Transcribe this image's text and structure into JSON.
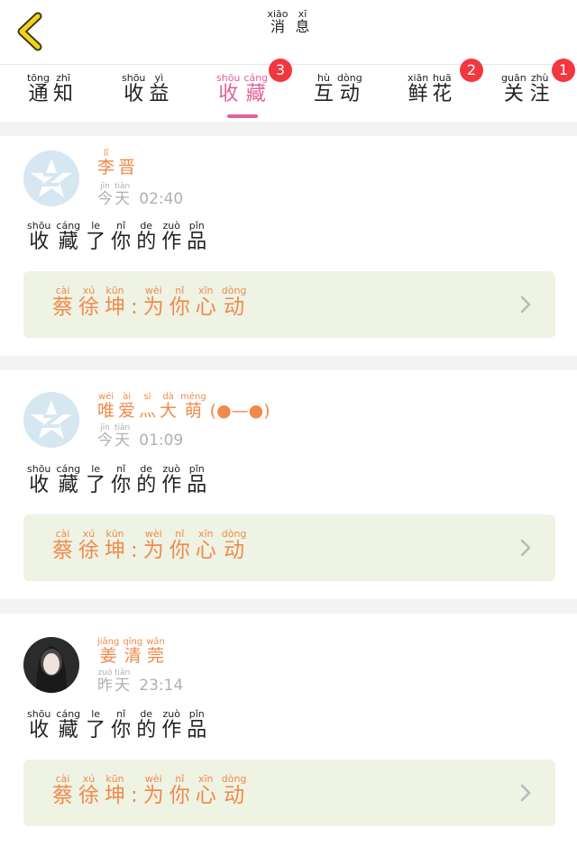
{
  "header": {
    "title": [
      {
        "py": "xiāo",
        "hz": "消"
      },
      {
        "py": "xī",
        "hz": "息"
      }
    ]
  },
  "tabs": [
    {
      "name": "notice",
      "chars": [
        {
          "py": "tōng",
          "hz": "通"
        },
        {
          "py": "zhī",
          "hz": "知"
        }
      ],
      "badge": ""
    },
    {
      "name": "earnings",
      "chars": [
        {
          "py": "shōu",
          "hz": "收"
        },
        {
          "py": "yì",
          "hz": "益"
        }
      ],
      "badge": ""
    },
    {
      "name": "favorites",
      "chars": [
        {
          "py": "shōu",
          "hz": "收"
        },
        {
          "py": "cáng",
          "hz": "藏"
        }
      ],
      "badge": "3",
      "active": true
    },
    {
      "name": "interaction",
      "chars": [
        {
          "py": "hù",
          "hz": "互"
        },
        {
          "py": "dòng",
          "hz": "动"
        }
      ],
      "badge": ""
    },
    {
      "name": "flowers",
      "chars": [
        {
          "py": "xiān",
          "hz": "鲜"
        },
        {
          "py": "huā",
          "hz": "花"
        }
      ],
      "badge": "2"
    },
    {
      "name": "follow",
      "chars": [
        {
          "py": "guān",
          "hz": "关"
        },
        {
          "py": "zhù",
          "hz": "注"
        }
      ],
      "badge": "1"
    }
  ],
  "messages": [
    {
      "user": [
        {
          "py": "lǐ",
          "hz": "李"
        },
        {
          "py": "",
          "hz": "晋"
        }
      ],
      "day": [
        {
          "py": "jīn",
          "hz": "今"
        },
        {
          "py": "tiān",
          "hz": "天"
        }
      ],
      "time": "02:40",
      "action": [
        {
          "py": "shōu",
          "hz": "收"
        },
        {
          "py": "cáng",
          "hz": "藏"
        },
        {
          "py": "le",
          "hz": "了"
        },
        {
          "py": "nǐ",
          "hz": "你"
        },
        {
          "py": "de",
          "hz": "的"
        },
        {
          "py": "zuò",
          "hz": "作"
        },
        {
          "py": "pǐn",
          "hz": "品"
        }
      ],
      "work": [
        {
          "py": "cài",
          "hz": "蔡"
        },
        {
          "py": "xú",
          "hz": "徐"
        },
        {
          "py": "kūn",
          "hz": "坤"
        },
        {
          "py": "",
          "hz": ":"
        },
        {
          "py": "wèi",
          "hz": "为"
        },
        {
          "py": "nǐ",
          "hz": "你"
        },
        {
          "py": "xīn",
          "hz": "心"
        },
        {
          "py": "dòng",
          "hz": "动"
        }
      ],
      "avatar": "default"
    },
    {
      "user": [
        {
          "py": "wéi",
          "hz": "唯"
        },
        {
          "py": "ài",
          "hz": "爱"
        },
        {
          "py": "sì",
          "hz": "灬"
        },
        {
          "py": "dà",
          "hz": "大"
        },
        {
          "py": "méng",
          "hz": "萌"
        },
        {
          "py": "",
          "hz": "(●—●)"
        }
      ],
      "day": [
        {
          "py": "jīn",
          "hz": "今"
        },
        {
          "py": "tiān",
          "hz": "天"
        }
      ],
      "time": "01:09",
      "action": [
        {
          "py": "shōu",
          "hz": "收"
        },
        {
          "py": "cáng",
          "hz": "藏"
        },
        {
          "py": "le",
          "hz": "了"
        },
        {
          "py": "nǐ",
          "hz": "你"
        },
        {
          "py": "de",
          "hz": "的"
        },
        {
          "py": "zuò",
          "hz": "作"
        },
        {
          "py": "pǐn",
          "hz": "品"
        }
      ],
      "work": [
        {
          "py": "cài",
          "hz": "蔡"
        },
        {
          "py": "xú",
          "hz": "徐"
        },
        {
          "py": "kūn",
          "hz": "坤"
        },
        {
          "py": "",
          "hz": ":"
        },
        {
          "py": "wèi",
          "hz": "为"
        },
        {
          "py": "nǐ",
          "hz": "你"
        },
        {
          "py": "xīn",
          "hz": "心"
        },
        {
          "py": "dòng",
          "hz": "动"
        }
      ],
      "avatar": "default"
    },
    {
      "user": [
        {
          "py": "jiāng",
          "hz": "姜"
        },
        {
          "py": "qīng",
          "hz": "清"
        },
        {
          "py": "wǎn",
          "hz": "莞"
        }
      ],
      "day": [
        {
          "py": "zuó",
          "hz": "昨"
        },
        {
          "py": "tiān",
          "hz": "天"
        }
      ],
      "time": "23:14",
      "action": [
        {
          "py": "shōu",
          "hz": "收"
        },
        {
          "py": "cáng",
          "hz": "藏"
        },
        {
          "py": "le",
          "hz": "了"
        },
        {
          "py": "nǐ",
          "hz": "你"
        },
        {
          "py": "de",
          "hz": "的"
        },
        {
          "py": "zuò",
          "hz": "作"
        },
        {
          "py": "pǐn",
          "hz": "品"
        }
      ],
      "work": [
        {
          "py": "cài",
          "hz": "蔡"
        },
        {
          "py": "xú",
          "hz": "徐"
        },
        {
          "py": "kūn",
          "hz": "坤"
        },
        {
          "py": "",
          "hz": ":"
        },
        {
          "py": "wèi",
          "hz": "为"
        },
        {
          "py": "nǐ",
          "hz": "你"
        },
        {
          "py": "xīn",
          "hz": "心"
        },
        {
          "py": "dòng",
          "hz": "动"
        }
      ],
      "avatar": "photo"
    }
  ],
  "colors": {
    "accent": "#e2609c",
    "badge": "#f2373f",
    "name": "#f08a4b",
    "work_bg": "#eef3e4"
  },
  "icons": {
    "back": "chevron-left-icon",
    "work_arrow": "chevron-right-icon",
    "default_avatar": "qzone-star-icon"
  }
}
